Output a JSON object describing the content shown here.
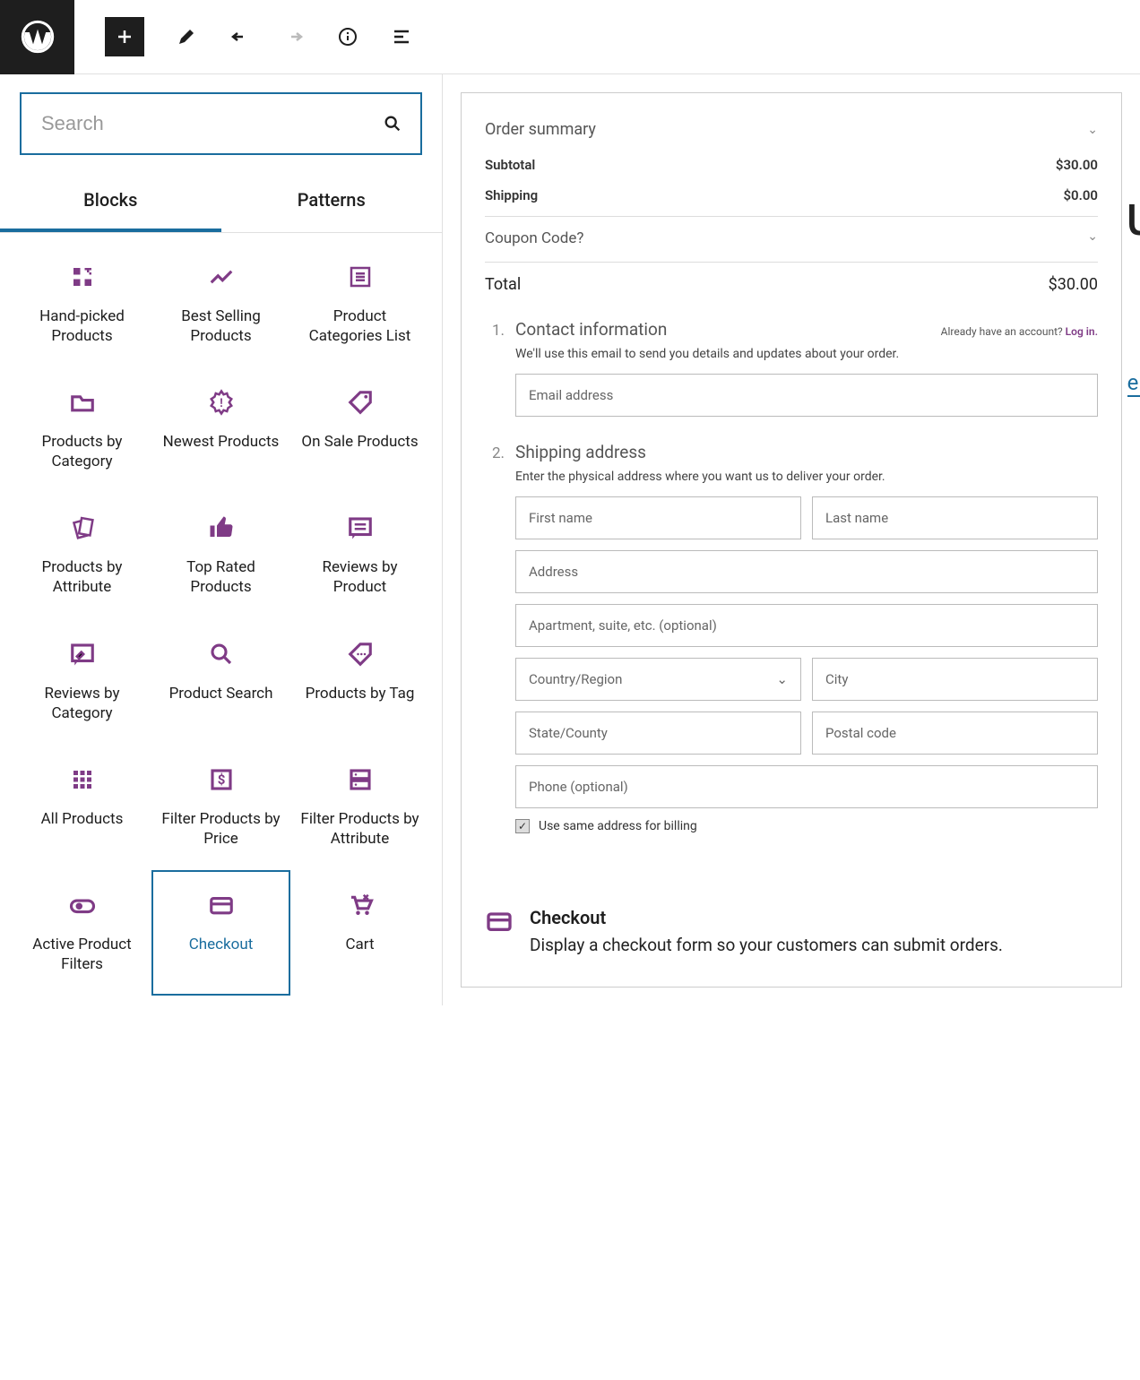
{
  "toolbar": {
    "logo": "wordpress"
  },
  "search": {
    "placeholder": "Search"
  },
  "tabs": {
    "blocks": "Blocks",
    "patterns": "Patterns"
  },
  "blocks": [
    {
      "id": "hand-picked-products",
      "label": "Hand-picked Products",
      "icon": "grid-plus"
    },
    {
      "id": "best-selling-products",
      "label": "Best Selling Products",
      "icon": "trend"
    },
    {
      "id": "product-categories-list",
      "label": "Product Categories List",
      "icon": "list-box"
    },
    {
      "id": "products-by-category",
      "label": "Products by Category",
      "icon": "folder"
    },
    {
      "id": "newest-products",
      "label": "Newest Products",
      "icon": "new-badge"
    },
    {
      "id": "on-sale-products",
      "label": "On Sale Products",
      "icon": "tag"
    },
    {
      "id": "products-by-attribute",
      "label": "Products by Attribute",
      "icon": "cards"
    },
    {
      "id": "top-rated-products",
      "label": "Top Rated Products",
      "icon": "thumbs-up"
    },
    {
      "id": "reviews-by-product",
      "label": "Reviews by Product",
      "icon": "review"
    },
    {
      "id": "reviews-by-category",
      "label": "Reviews by Category",
      "icon": "review-edit"
    },
    {
      "id": "product-search",
      "label": "Product Search",
      "icon": "search"
    },
    {
      "id": "products-by-tag",
      "label": "Products by Tag",
      "icon": "tag-dots"
    },
    {
      "id": "all-products",
      "label": "All Products",
      "icon": "grid9"
    },
    {
      "id": "filter-products-by-price",
      "label": "Filter Products by Price",
      "icon": "price-box"
    },
    {
      "id": "filter-products-by-attribute",
      "label": "Filter Products by Attribute",
      "icon": "server"
    },
    {
      "id": "active-product-filters",
      "label": "Active Product Filters",
      "icon": "toggle"
    },
    {
      "id": "checkout",
      "label": "Checkout",
      "icon": "card",
      "selected": true
    },
    {
      "id": "cart",
      "label": "Cart",
      "icon": "cart"
    }
  ],
  "preview": {
    "order_summary": {
      "title": "Order summary",
      "subtotal_label": "Subtotal",
      "subtotal_value": "$30.00",
      "shipping_label": "Shipping",
      "shipping_value": "$0.00",
      "coupon_label": "Coupon Code?",
      "total_label": "Total",
      "total_value": "$30.00"
    },
    "steps": {
      "contact": {
        "num": "1.",
        "title": "Contact information",
        "already": "Already have an account?",
        "login": "Log in.",
        "desc": "We'll use this email to send you details and updates about your order.",
        "email_placeholder": "Email address"
      },
      "shipping": {
        "num": "2.",
        "title": "Shipping address",
        "desc": "Enter the physical address where you want us to deliver your order.",
        "first_name": "First name",
        "last_name": "Last name",
        "address": "Address",
        "apt": "Apartment, suite, etc. (optional)",
        "country": "Country/Region",
        "city": "City",
        "state": "State/County",
        "postal": "Postal code",
        "phone": "Phone (optional)",
        "same_billing": "Use same address for billing"
      }
    },
    "desc": {
      "title": "Checkout",
      "text": "Display a checkout form so your customers can submit orders."
    },
    "bg": {
      "t1": "ut",
      "t2": "e / to c"
    }
  }
}
